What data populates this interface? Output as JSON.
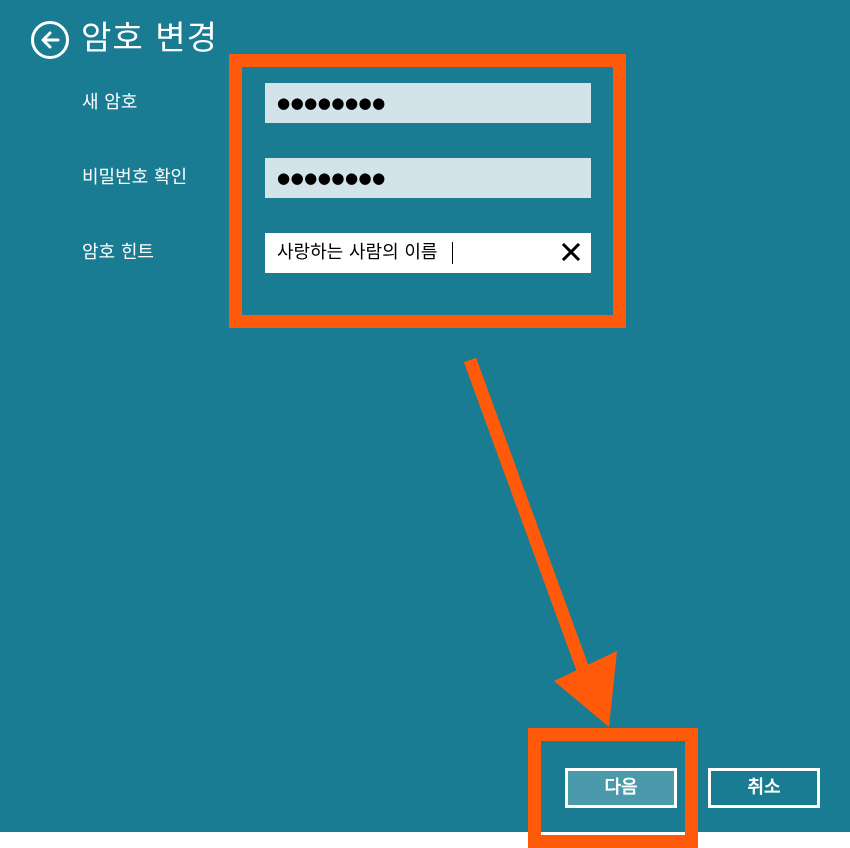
{
  "header": {
    "title": "암호 변경",
    "back_icon": "back-arrow-circle-icon"
  },
  "form": {
    "new_password": {
      "label": "새 암호",
      "value": "●●●●●●●●"
    },
    "confirm_password": {
      "label": "비밀번호 확인",
      "value": "●●●●●●●●"
    },
    "password_hint": {
      "label": "암호 힌트",
      "value": "사랑하는 사람의 이름",
      "clear_icon": "close-icon"
    }
  },
  "footer": {
    "next_label": "다음",
    "cancel_label": "취소"
  },
  "colors": {
    "background": "#1a7c92",
    "field_bg": "#d2e3ea",
    "annotation": "#ff5a0a",
    "next_button_bg": "#4a9aab"
  }
}
